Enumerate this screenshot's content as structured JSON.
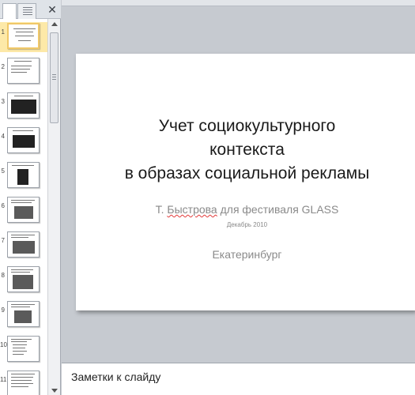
{
  "left_pane": {
    "close_glyph": "✕",
    "thumbnails": [
      {
        "number": "1",
        "selected": true
      },
      {
        "number": "2"
      },
      {
        "number": "3"
      },
      {
        "number": "4"
      },
      {
        "number": "5"
      },
      {
        "number": "6"
      },
      {
        "number": "7"
      },
      {
        "number": "8"
      },
      {
        "number": "9"
      },
      {
        "number": "10"
      },
      {
        "number": "11"
      }
    ]
  },
  "slide": {
    "title": "Учет социокультурного\nконтекста\nв образах социальной рекламы",
    "subtitle_prefix": "Т. ",
    "subtitle_name": "Быстрова",
    "subtitle_rest": " для фестиваля GLASS",
    "date": "Декабрь 2010",
    "city": "Екатеринбург"
  },
  "notes": {
    "placeholder": "Заметки к слайду"
  },
  "colors": {
    "selected_thumb_border": "#f0c869",
    "spell_underline": "#e23a3a"
  }
}
